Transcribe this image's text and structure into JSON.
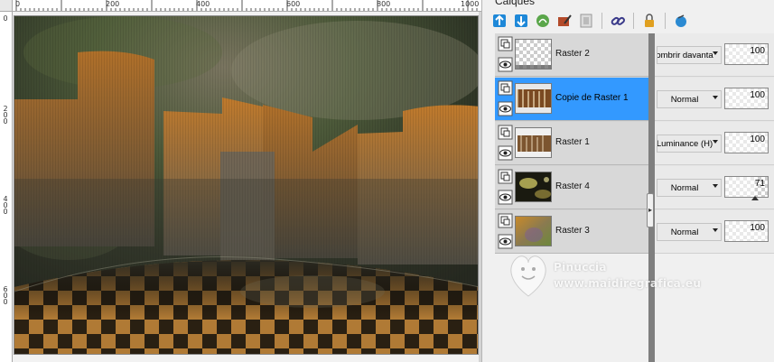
{
  "canvas": {
    "ruler_top_labels": [
      "0",
      "200",
      "400",
      "600",
      "800",
      "1000"
    ],
    "ruler_left_labels": [
      "0",
      "2 0 0",
      "4 0 0",
      "6 0 0"
    ]
  },
  "layers_panel": {
    "title": "Calques",
    "icons": [
      "new-raster-layer-icon",
      "new-vector-layer-icon",
      "new-mask-layer-icon",
      "edit-selection-icon",
      "mask-layer-icon",
      "link-icon",
      "lock-icon",
      "delete-layer-icon"
    ],
    "layers": [
      {
        "name": "Raster 2",
        "blend": "ombrir davanta",
        "opacity": 100,
        "opacity_text": "100",
        "selected": false
      },
      {
        "name": "Copie de Raster 1",
        "blend": "Normal",
        "opacity": 100,
        "opacity_text": "100",
        "selected": true
      },
      {
        "name": "Raster 1",
        "blend": "Luminance (H)",
        "opacity": 100,
        "opacity_text": "100",
        "selected": false
      },
      {
        "name": "Raster 4",
        "blend": "Normal",
        "opacity": 71,
        "opacity_text": "71",
        "selected": false
      },
      {
        "name": "Raster 3",
        "blend": "Normal",
        "opacity": 100,
        "opacity_text": "100",
        "selected": false
      }
    ],
    "selected_color": "#3399ff"
  },
  "watermark": {
    "name": "Pinuccia",
    "url": "www.maidiregrafica.eu"
  }
}
